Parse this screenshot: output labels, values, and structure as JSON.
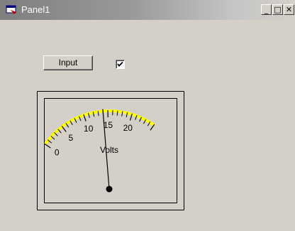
{
  "window": {
    "title": "Panel1",
    "controls": {
      "minimize": "_",
      "maximize": "□",
      "close": "✕"
    }
  },
  "panel": {
    "input_button_label": "Input",
    "checkbox_checked": true
  },
  "meter": {
    "label": "Volts",
    "scale_min": 0,
    "scale_max": 25,
    "tick_labels": [
      "0",
      "5",
      "10",
      "15",
      "20"
    ],
    "needle_value": 14,
    "arc_color": "#ffff00",
    "tick_color": "#000000"
  }
}
